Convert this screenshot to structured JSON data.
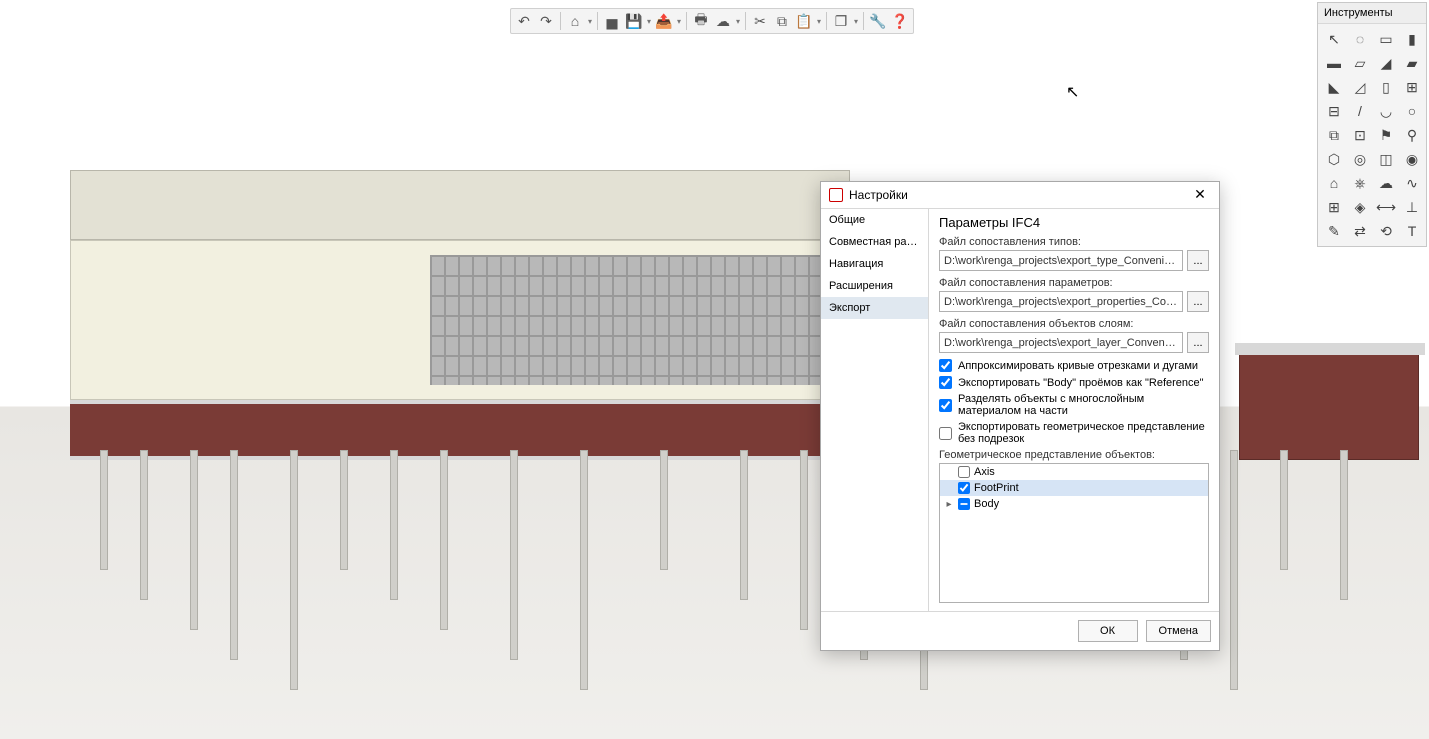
{
  "toolbar": {
    "items": [
      {
        "name": "undo-icon",
        "glyph": "↶"
      },
      {
        "name": "redo-icon",
        "glyph": "↷"
      },
      {
        "name": "home-icon",
        "glyph": "⌂",
        "dd": true
      },
      {
        "name": "open-icon",
        "glyph": "▅"
      },
      {
        "name": "save-icon",
        "glyph": "💾",
        "dd": true
      },
      {
        "name": "export-icon",
        "glyph": "📤",
        "dd": true
      },
      {
        "name": "print-icon",
        "glyph": "🖶"
      },
      {
        "name": "publish-icon",
        "glyph": "☁",
        "dd": true
      },
      {
        "name": "cut-icon",
        "glyph": "✂"
      },
      {
        "name": "copy-icon",
        "glyph": "⧉"
      },
      {
        "name": "paste-icon",
        "glyph": "📋",
        "dd": true
      },
      {
        "name": "views-icon",
        "glyph": "❐",
        "dd": true
      },
      {
        "name": "settings-icon",
        "glyph": "🔧"
      },
      {
        "name": "help-icon",
        "glyph": "❓"
      }
    ]
  },
  "tools_panel": {
    "title": "Инструменты",
    "tools": [
      {
        "name": "select-icon",
        "glyph": "↖"
      },
      {
        "name": "lasso-icon",
        "glyph": "◌"
      },
      {
        "name": "box-icon",
        "glyph": "▭"
      },
      {
        "name": "column-icon",
        "glyph": "▮"
      },
      {
        "name": "wall-icon",
        "glyph": "▬"
      },
      {
        "name": "slab-icon",
        "glyph": "▱"
      },
      {
        "name": "beam-icon",
        "glyph": "◢"
      },
      {
        "name": "eraser-icon",
        "glyph": "▰"
      },
      {
        "name": "roof-icon",
        "glyph": "◣"
      },
      {
        "name": "ramp-icon",
        "glyph": "◿"
      },
      {
        "name": "door-icon",
        "glyph": "▯"
      },
      {
        "name": "window-icon",
        "glyph": "⊞"
      },
      {
        "name": "table-icon",
        "glyph": "⊟"
      },
      {
        "name": "line-icon",
        "glyph": "/"
      },
      {
        "name": "arc-icon",
        "glyph": "◡"
      },
      {
        "name": "circle-icon",
        "glyph": "○"
      },
      {
        "name": "group-icon",
        "glyph": "⧉"
      },
      {
        "name": "section-icon",
        "glyph": "⊡"
      },
      {
        "name": "tag-icon",
        "glyph": "⚑"
      },
      {
        "name": "bolt-icon",
        "glyph": "⚲"
      },
      {
        "name": "component-icon",
        "glyph": "⬡"
      },
      {
        "name": "pipe-icon",
        "glyph": "◎"
      },
      {
        "name": "duct-icon",
        "glyph": "◫"
      },
      {
        "name": "face-icon",
        "glyph": "◉"
      },
      {
        "name": "equip-icon",
        "glyph": "⌂"
      },
      {
        "name": "tree-icon",
        "glyph": "⎈"
      },
      {
        "name": "cloud-icon",
        "glyph": "☁"
      },
      {
        "name": "curve-icon",
        "glyph": "∿"
      },
      {
        "name": "grid-icon",
        "glyph": "⊞"
      },
      {
        "name": "cube-icon",
        "glyph": "◈"
      },
      {
        "name": "dim-icon",
        "glyph": "⟷"
      },
      {
        "name": "level-icon",
        "glyph": "⊥"
      },
      {
        "name": "edit-icon",
        "glyph": "✎"
      },
      {
        "name": "mirror-icon",
        "glyph": "⇄"
      },
      {
        "name": "rotate-icon",
        "glyph": "⟲"
      },
      {
        "name": "text-icon",
        "glyph": "T"
      }
    ]
  },
  "dialog": {
    "title": "Настройки",
    "nav": {
      "items": [
        {
          "label": "Общие",
          "key": "general"
        },
        {
          "label": "Совместная работа",
          "key": "collab"
        },
        {
          "label": "Навигация",
          "key": "navigation"
        },
        {
          "label": "Расширения",
          "key": "extensions"
        },
        {
          "label": "Экспорт",
          "key": "export",
          "selected": true
        }
      ]
    },
    "content": {
      "heading": "Параметры IFC4",
      "type_file_label": "Файл сопоставления типов:",
      "type_file_value": "D:\\work\\renga_projects\\export_type_Convenience store.json",
      "param_file_label": "Файл сопоставления параметров:",
      "param_file_value": "D:\\work\\renga_projects\\export_properties_Convenience store.j",
      "layer_file_label": "Файл сопоставления объектов слоям:",
      "layer_file_value": "D:\\work\\renga_projects\\export_layer_Convenience store.json",
      "browse_label": "...",
      "check1": {
        "label": "Аппроксимировать кривые отрезками и дугами",
        "checked": true
      },
      "check2": {
        "label": "Экспортировать \"Body\" проёмов как \"Reference\"",
        "checked": true
      },
      "check3": {
        "label": "Разделять объекты с многослойным материалом на части",
        "checked": true
      },
      "check4": {
        "label": "Экспортировать геометрическое представление без подрезок",
        "checked": false
      },
      "tree_label": "Геометрическое представление объектов:",
      "tree": [
        {
          "label": "Axis",
          "checked": false,
          "expand": ""
        },
        {
          "label": "FootPrint",
          "checked": true,
          "selected": true,
          "expand": ""
        },
        {
          "label": "Body",
          "checked": "mixed",
          "expand": "▸"
        }
      ]
    },
    "buttons": {
      "ok": "ОК",
      "cancel": "Отмена"
    }
  }
}
